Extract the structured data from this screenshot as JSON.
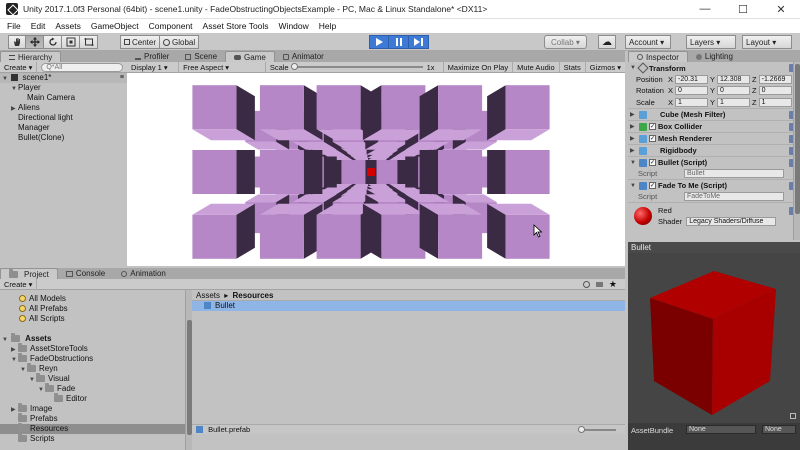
{
  "window": {
    "title": "Unity 2017.1.0f3 Personal (64bit) - scene1.unity - FadeObstructingObjectsExample - PC, Mac & Linux Standalone* <DX11>",
    "minimize": "—",
    "maximize": "☐",
    "close": "✕"
  },
  "menu": [
    "File",
    "Edit",
    "Assets",
    "GameObject",
    "Component",
    "Asset Store Tools",
    "Window",
    "Help"
  ],
  "toolbar": {
    "center_label": "Center",
    "global_label": "Global",
    "collab_label": "Collab ▾",
    "account_label": "Account ▾",
    "layers_label": "Layers ▾",
    "layout_label": "Layout ▾",
    "cloud_glyph": "☁"
  },
  "hierarchy": {
    "tab": "Hierarchy",
    "create": "Create ▾",
    "search_placeholder": "Q*All",
    "scene": "scene1*",
    "items": [
      {
        "label": "Player",
        "indent": 1,
        "arrow": "▼"
      },
      {
        "label": "Main Camera",
        "indent": 2,
        "arrow": ""
      },
      {
        "label": "Aliens",
        "indent": 1,
        "arrow": "▶"
      },
      {
        "label": "Directional light",
        "indent": 1,
        "arrow": ""
      },
      {
        "label": "Manager",
        "indent": 1,
        "arrow": ""
      },
      {
        "label": "Bullet(Clone)",
        "indent": 1,
        "arrow": ""
      }
    ]
  },
  "center_tabs": [
    {
      "label": "Profiler",
      "active": false
    },
    {
      "label": "Scene",
      "active": false
    },
    {
      "label": "Game",
      "active": true
    },
    {
      "label": "Animator",
      "active": false
    }
  ],
  "game_bar": {
    "display": "Display 1 ▾",
    "aspect": "Free Aspect ▾",
    "scale_label": "Scale",
    "scale_value": "1x",
    "maximize": "Maximize On Play",
    "mute": "Mute Audio",
    "stats": "Stats",
    "gizmos": "Gizmos ▾"
  },
  "inspector": {
    "tabs": [
      {
        "label": "Inspector",
        "active": true
      },
      {
        "label": "Lighting",
        "active": false
      }
    ],
    "transform_label": "Transform",
    "position_label": "Position",
    "rotation_label": "Rotation",
    "scale_label": "Scale",
    "position": {
      "x": "-20.31",
      "y": "12.308",
      "z": "-1.2669"
    },
    "rotation": {
      "x": "0",
      "y": "0",
      "z": "0"
    },
    "scale": {
      "x": "1",
      "y": "1",
      "z": "1"
    },
    "components": [
      {
        "label": "Cube (Mesh Filter)",
        "checkbox": false,
        "color": "#5aa0d8"
      },
      {
        "label": "Box Collider",
        "checkbox": true,
        "color": "#3da84a"
      },
      {
        "label": "Mesh Renderer",
        "checkbox": true,
        "color": "#5aa0d8"
      },
      {
        "label": "Rigidbody",
        "checkbox": false,
        "color": "#5aa0d8"
      }
    ],
    "bullet_script": {
      "label": "Bullet (Script)",
      "script_label": "Script",
      "script_value": "Bullet"
    },
    "fade_script": {
      "label": "Fade To Me (Script)",
      "script_label": "Script",
      "script_value": "FadeToMe"
    },
    "material": {
      "name": "Red",
      "shader_label": "Shader",
      "shader_value": "Legacy Shaders/Diffuse"
    }
  },
  "preview": {
    "title": "Bullet",
    "asset_bundle_label": "AssetBundle",
    "bundle_value": "None",
    "variant_value": "None"
  },
  "project_tabs": [
    {
      "label": "Project",
      "active": true
    },
    {
      "label": "Console",
      "active": false
    },
    {
      "label": "Animation",
      "active": false
    }
  ],
  "project": {
    "create": "Create ▾",
    "favorites": [
      {
        "label": "All Models",
        "indent": 1
      },
      {
        "label": "All Prefabs",
        "indent": 1
      },
      {
        "label": "All Scripts",
        "indent": 1
      }
    ],
    "assets_root": "Assets",
    "tree": [
      {
        "label": "AssetStoreTools",
        "indent": 1,
        "arrow": "▶"
      },
      {
        "label": "FadeObstructions",
        "indent": 1,
        "arrow": "▼"
      },
      {
        "label": "Reyn",
        "indent": 2,
        "arrow": "▼"
      },
      {
        "label": "Visual",
        "indent": 3,
        "arrow": "▼"
      },
      {
        "label": "Fade",
        "indent": 4,
        "arrow": "▼"
      },
      {
        "label": "Editor",
        "indent": 5,
        "arrow": ""
      },
      {
        "label": "Image",
        "indent": 1,
        "arrow": "▶"
      },
      {
        "label": "Prefabs",
        "indent": 1,
        "arrow": ""
      },
      {
        "label": "Resources",
        "indent": 1,
        "arrow": "",
        "selected": true
      },
      {
        "label": "Scripts",
        "indent": 1,
        "arrow": ""
      }
    ],
    "breadcrumb": {
      "root": "Assets",
      "sep": "▸",
      "current": "Resources"
    },
    "files": [
      "Bullet"
    ],
    "selected_path": "Bullet.prefab"
  }
}
